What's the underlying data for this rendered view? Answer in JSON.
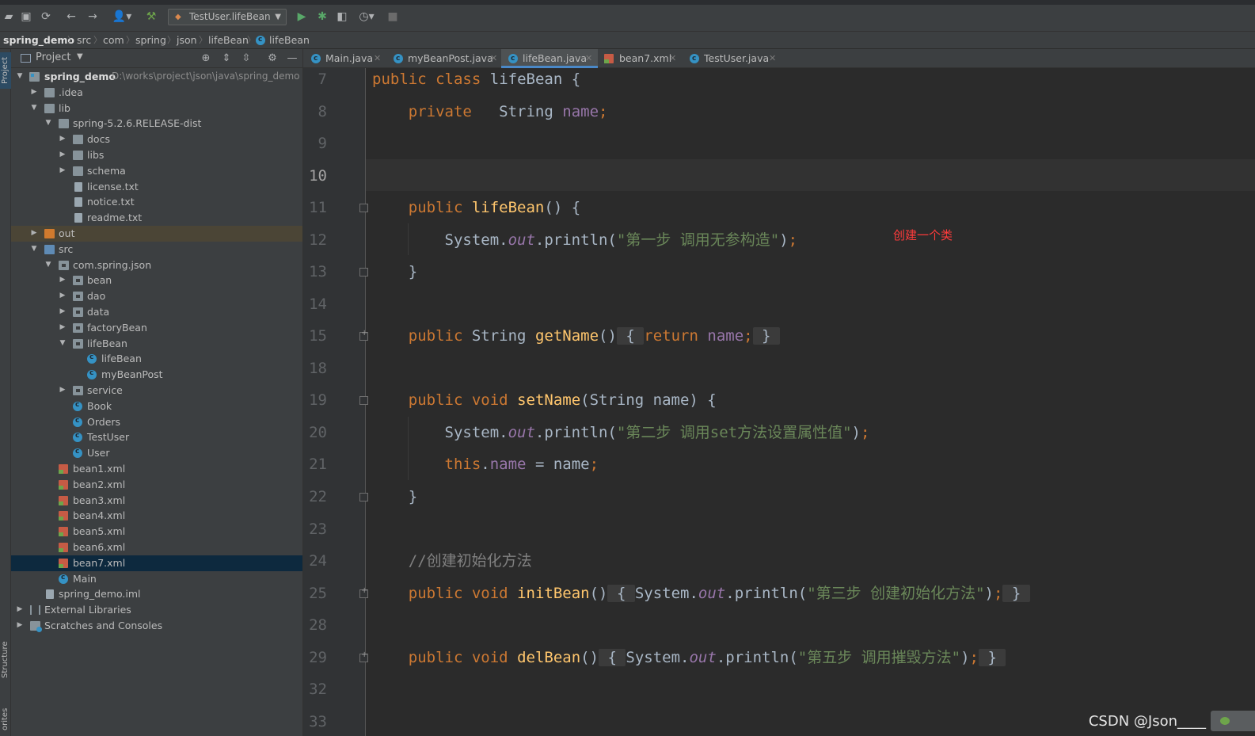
{
  "toolbar": {
    "run_config": "TestUser.lifeBean",
    "icons": [
      "open-folder-icon",
      "save-icon",
      "sync-icon",
      "back-icon",
      "forward-icon",
      "user-icon",
      "build-hammer-icon",
      "run-icon",
      "debug-icon",
      "coverage-icon",
      "profile-icon",
      "stop-icon"
    ]
  },
  "breadcrumb": [
    "spring_demo",
    "src",
    "com",
    "spring",
    "json",
    "lifeBean",
    "lifeBean"
  ],
  "left_strip": {
    "project_tab": "Project",
    "structure_tab": "Structure",
    "favorites_tab": "orites"
  },
  "project_panel": {
    "title": "Project",
    "tree": [
      {
        "label": "spring_demo",
        "path": "D:\\works\\project\\json\\java\\spring_demo"
      },
      {
        "label": ".idea"
      },
      {
        "label": "lib"
      },
      {
        "label": "spring-5.2.6.RELEASE-dist"
      },
      {
        "label": "docs"
      },
      {
        "label": "libs"
      },
      {
        "label": "schema"
      },
      {
        "label": "license.txt"
      },
      {
        "label": "notice.txt"
      },
      {
        "label": "readme.txt"
      },
      {
        "label": "out"
      },
      {
        "label": "src"
      },
      {
        "label": "com.spring.json"
      },
      {
        "label": "bean"
      },
      {
        "label": "dao"
      },
      {
        "label": "data"
      },
      {
        "label": "factoryBean"
      },
      {
        "label": "lifeBean"
      },
      {
        "label": "lifeBean"
      },
      {
        "label": "myBeanPost"
      },
      {
        "label": "service"
      },
      {
        "label": "Book"
      },
      {
        "label": "Orders"
      },
      {
        "label": "TestUser"
      },
      {
        "label": "User"
      },
      {
        "label": "bean1.xml"
      },
      {
        "label": "bean2.xml"
      },
      {
        "label": "bean3.xml"
      },
      {
        "label": "bean4.xml"
      },
      {
        "label": "bean5.xml"
      },
      {
        "label": "bean6.xml"
      },
      {
        "label": "bean7.xml"
      },
      {
        "label": "Main"
      },
      {
        "label": "spring_demo.iml"
      },
      {
        "label": "External Libraries"
      },
      {
        "label": "Scratches and Consoles"
      }
    ]
  },
  "tabs": [
    "Main.java",
    "myBeanPost.java",
    "lifeBean.java",
    "bean7.xml",
    "TestUser.java"
  ],
  "editor": {
    "line_numbers": [
      "7",
      "8",
      "9",
      "10",
      "11",
      "12",
      "13",
      "14",
      "15",
      "18",
      "19",
      "20",
      "21",
      "22",
      "23",
      "24",
      "25",
      "28",
      "29",
      "32",
      "33"
    ],
    "code": {
      "l7": [
        "public",
        "class",
        "lifeBean",
        "{"
      ],
      "l8": [
        "private",
        "String",
        "name",
        ";"
      ],
      "l11": [
        "public",
        "lifeBean",
        "() {"
      ],
      "l12": [
        "System.",
        "out",
        ".println(",
        "\"第一步 调用无参构造\"",
        ")",
        ";"
      ],
      "l13": [
        "}"
      ],
      "l15": [
        "public",
        "String",
        "getName",
        "()",
        "{",
        "return",
        "name",
        ";",
        "}"
      ],
      "l19": [
        "public",
        "void",
        "setName",
        "(String name) {"
      ],
      "l20": [
        "System.",
        "out",
        ".println(",
        "\"第二步 调用set方法设置属性值\"",
        ")",
        ";"
      ],
      "l21": [
        "this",
        ".",
        "name",
        " = name",
        ";"
      ],
      "l22": [
        "}"
      ],
      "l24": [
        "//创建初始化方法"
      ],
      "l25": [
        "public",
        "void",
        "initBean",
        "()",
        "{",
        "System.",
        "out",
        ".println(",
        "\"第三步 创建初始化方法\"",
        ")",
        ";",
        "}"
      ],
      "l29": [
        "public",
        "void",
        "delBean",
        "()",
        "{",
        "System.",
        "out",
        ".println(",
        "\"第五步 调用摧毁方法\"",
        ")",
        ";",
        "}"
      ]
    },
    "annotation": "创建一个类"
  },
  "watermark": "CSDN @Json____"
}
